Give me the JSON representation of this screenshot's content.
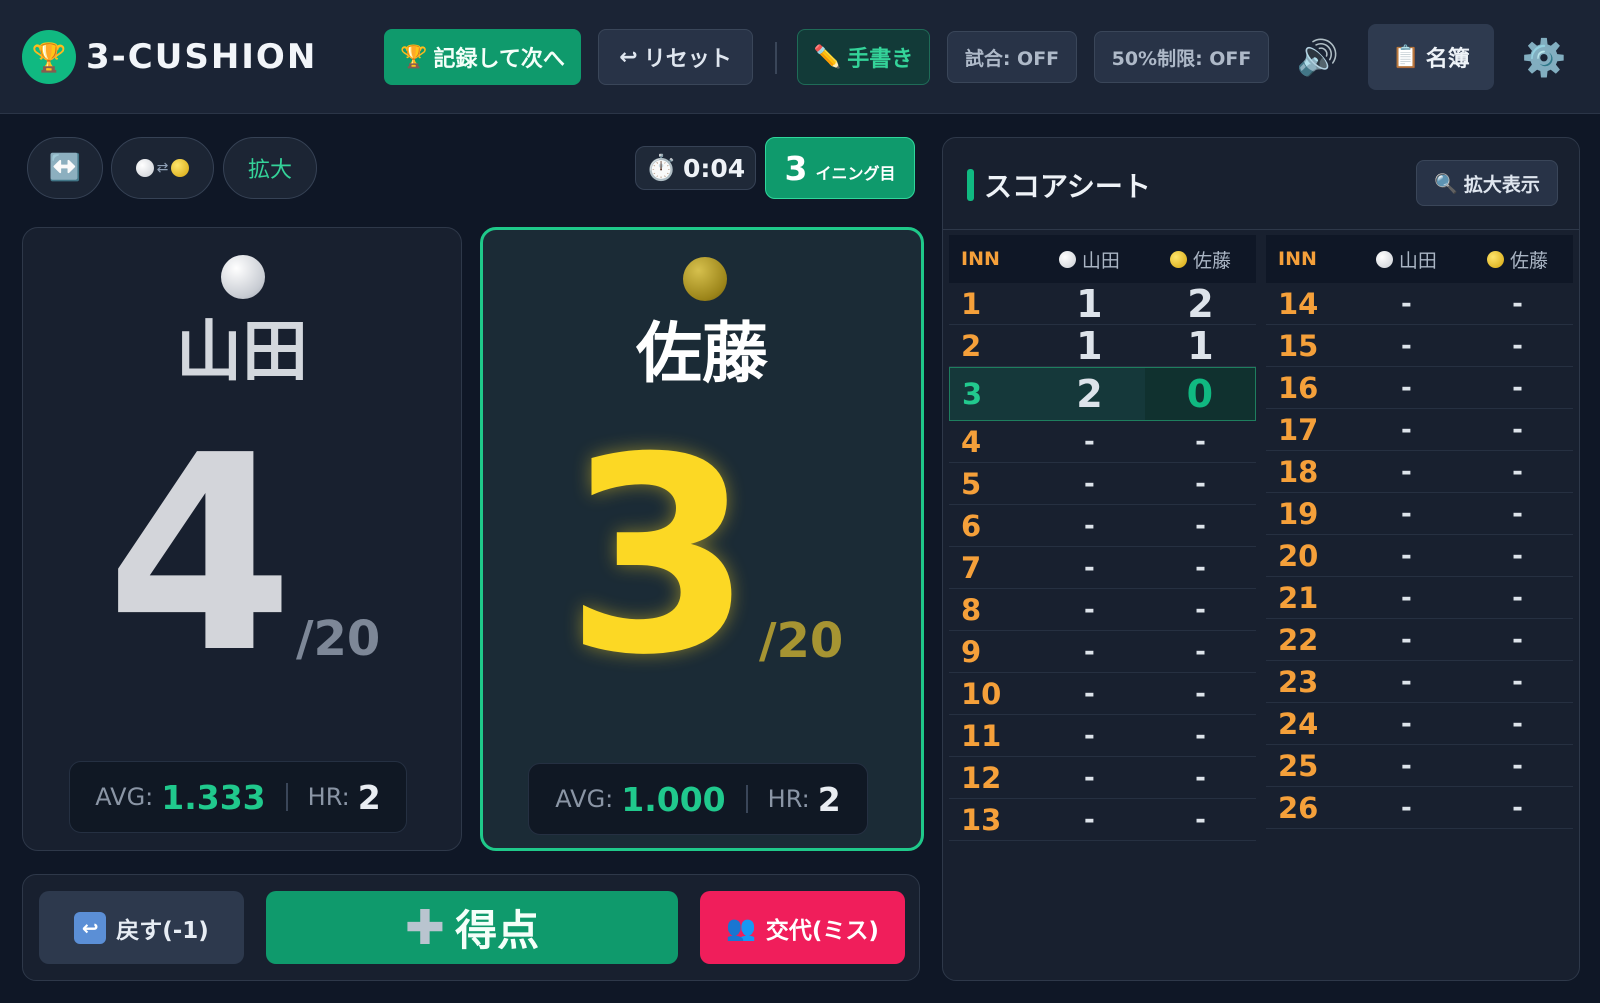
{
  "header": {
    "title": "3-CUSHION",
    "record_next": "記録して次へ",
    "reset": "リセット",
    "handwriting": "手書き",
    "match_toggle": "試合: OFF",
    "limit_toggle": "50%制限: OFF",
    "roster": "名簿"
  },
  "tools": {
    "zoom": "拡大",
    "timer": "0:04",
    "inning_number": "3",
    "inning_label": "イニング目"
  },
  "players": {
    "left": {
      "name": "山田",
      "ball": "white",
      "score": "4",
      "target": "/20",
      "avg_label": "AVG:",
      "avg": "1.333",
      "hr_label": "HR:",
      "hr": "2"
    },
    "right": {
      "name": "佐藤",
      "ball": "yellow",
      "score": "3",
      "target": "/20",
      "avg_label": "AVG:",
      "avg": "1.000",
      "hr_label": "HR:",
      "hr": "2",
      "active": true
    }
  },
  "actions": {
    "undo": "戻す(-1)",
    "score": "得点",
    "change": "交代(ミス)"
  },
  "scoresheet": {
    "title": "スコアシート",
    "zoom_button": "拡大表示",
    "header_inn": "INN",
    "player1": "山田",
    "player2": "佐藤",
    "current_inning": 3,
    "rows": [
      {
        "inn": "1",
        "p1": "1",
        "p2": "2"
      },
      {
        "inn": "2",
        "p1": "1",
        "p2": "1"
      },
      {
        "inn": "3",
        "p1": "2",
        "p2": "0"
      },
      {
        "inn": "4",
        "p1": "-",
        "p2": "-"
      },
      {
        "inn": "5",
        "p1": "-",
        "p2": "-"
      },
      {
        "inn": "6",
        "p1": "-",
        "p2": "-"
      },
      {
        "inn": "7",
        "p1": "-",
        "p2": "-"
      },
      {
        "inn": "8",
        "p1": "-",
        "p2": "-"
      },
      {
        "inn": "9",
        "p1": "-",
        "p2": "-"
      },
      {
        "inn": "10",
        "p1": "-",
        "p2": "-"
      },
      {
        "inn": "11",
        "p1": "-",
        "p2": "-"
      },
      {
        "inn": "12",
        "p1": "-",
        "p2": "-"
      },
      {
        "inn": "13",
        "p1": "-",
        "p2": "-"
      },
      {
        "inn": "14",
        "p1": "-",
        "p2": "-"
      },
      {
        "inn": "15",
        "p1": "-",
        "p2": "-"
      },
      {
        "inn": "16",
        "p1": "-",
        "p2": "-"
      },
      {
        "inn": "17",
        "p1": "-",
        "p2": "-"
      },
      {
        "inn": "18",
        "p1": "-",
        "p2": "-"
      },
      {
        "inn": "19",
        "p1": "-",
        "p2": "-"
      },
      {
        "inn": "20",
        "p1": "-",
        "p2": "-"
      },
      {
        "inn": "21",
        "p1": "-",
        "p2": "-"
      },
      {
        "inn": "22",
        "p1": "-",
        "p2": "-"
      },
      {
        "inn": "23",
        "p1": "-",
        "p2": "-"
      },
      {
        "inn": "24",
        "p1": "-",
        "p2": "-"
      },
      {
        "inn": "25",
        "p1": "-",
        "p2": "-"
      },
      {
        "inn": "26",
        "p1": "-",
        "p2": "-"
      }
    ]
  },
  "colors": {
    "accent": "#10b981",
    "innings": "#f5a03a",
    "danger": "#f01e5b",
    "yellow_score": "#fcd824"
  }
}
